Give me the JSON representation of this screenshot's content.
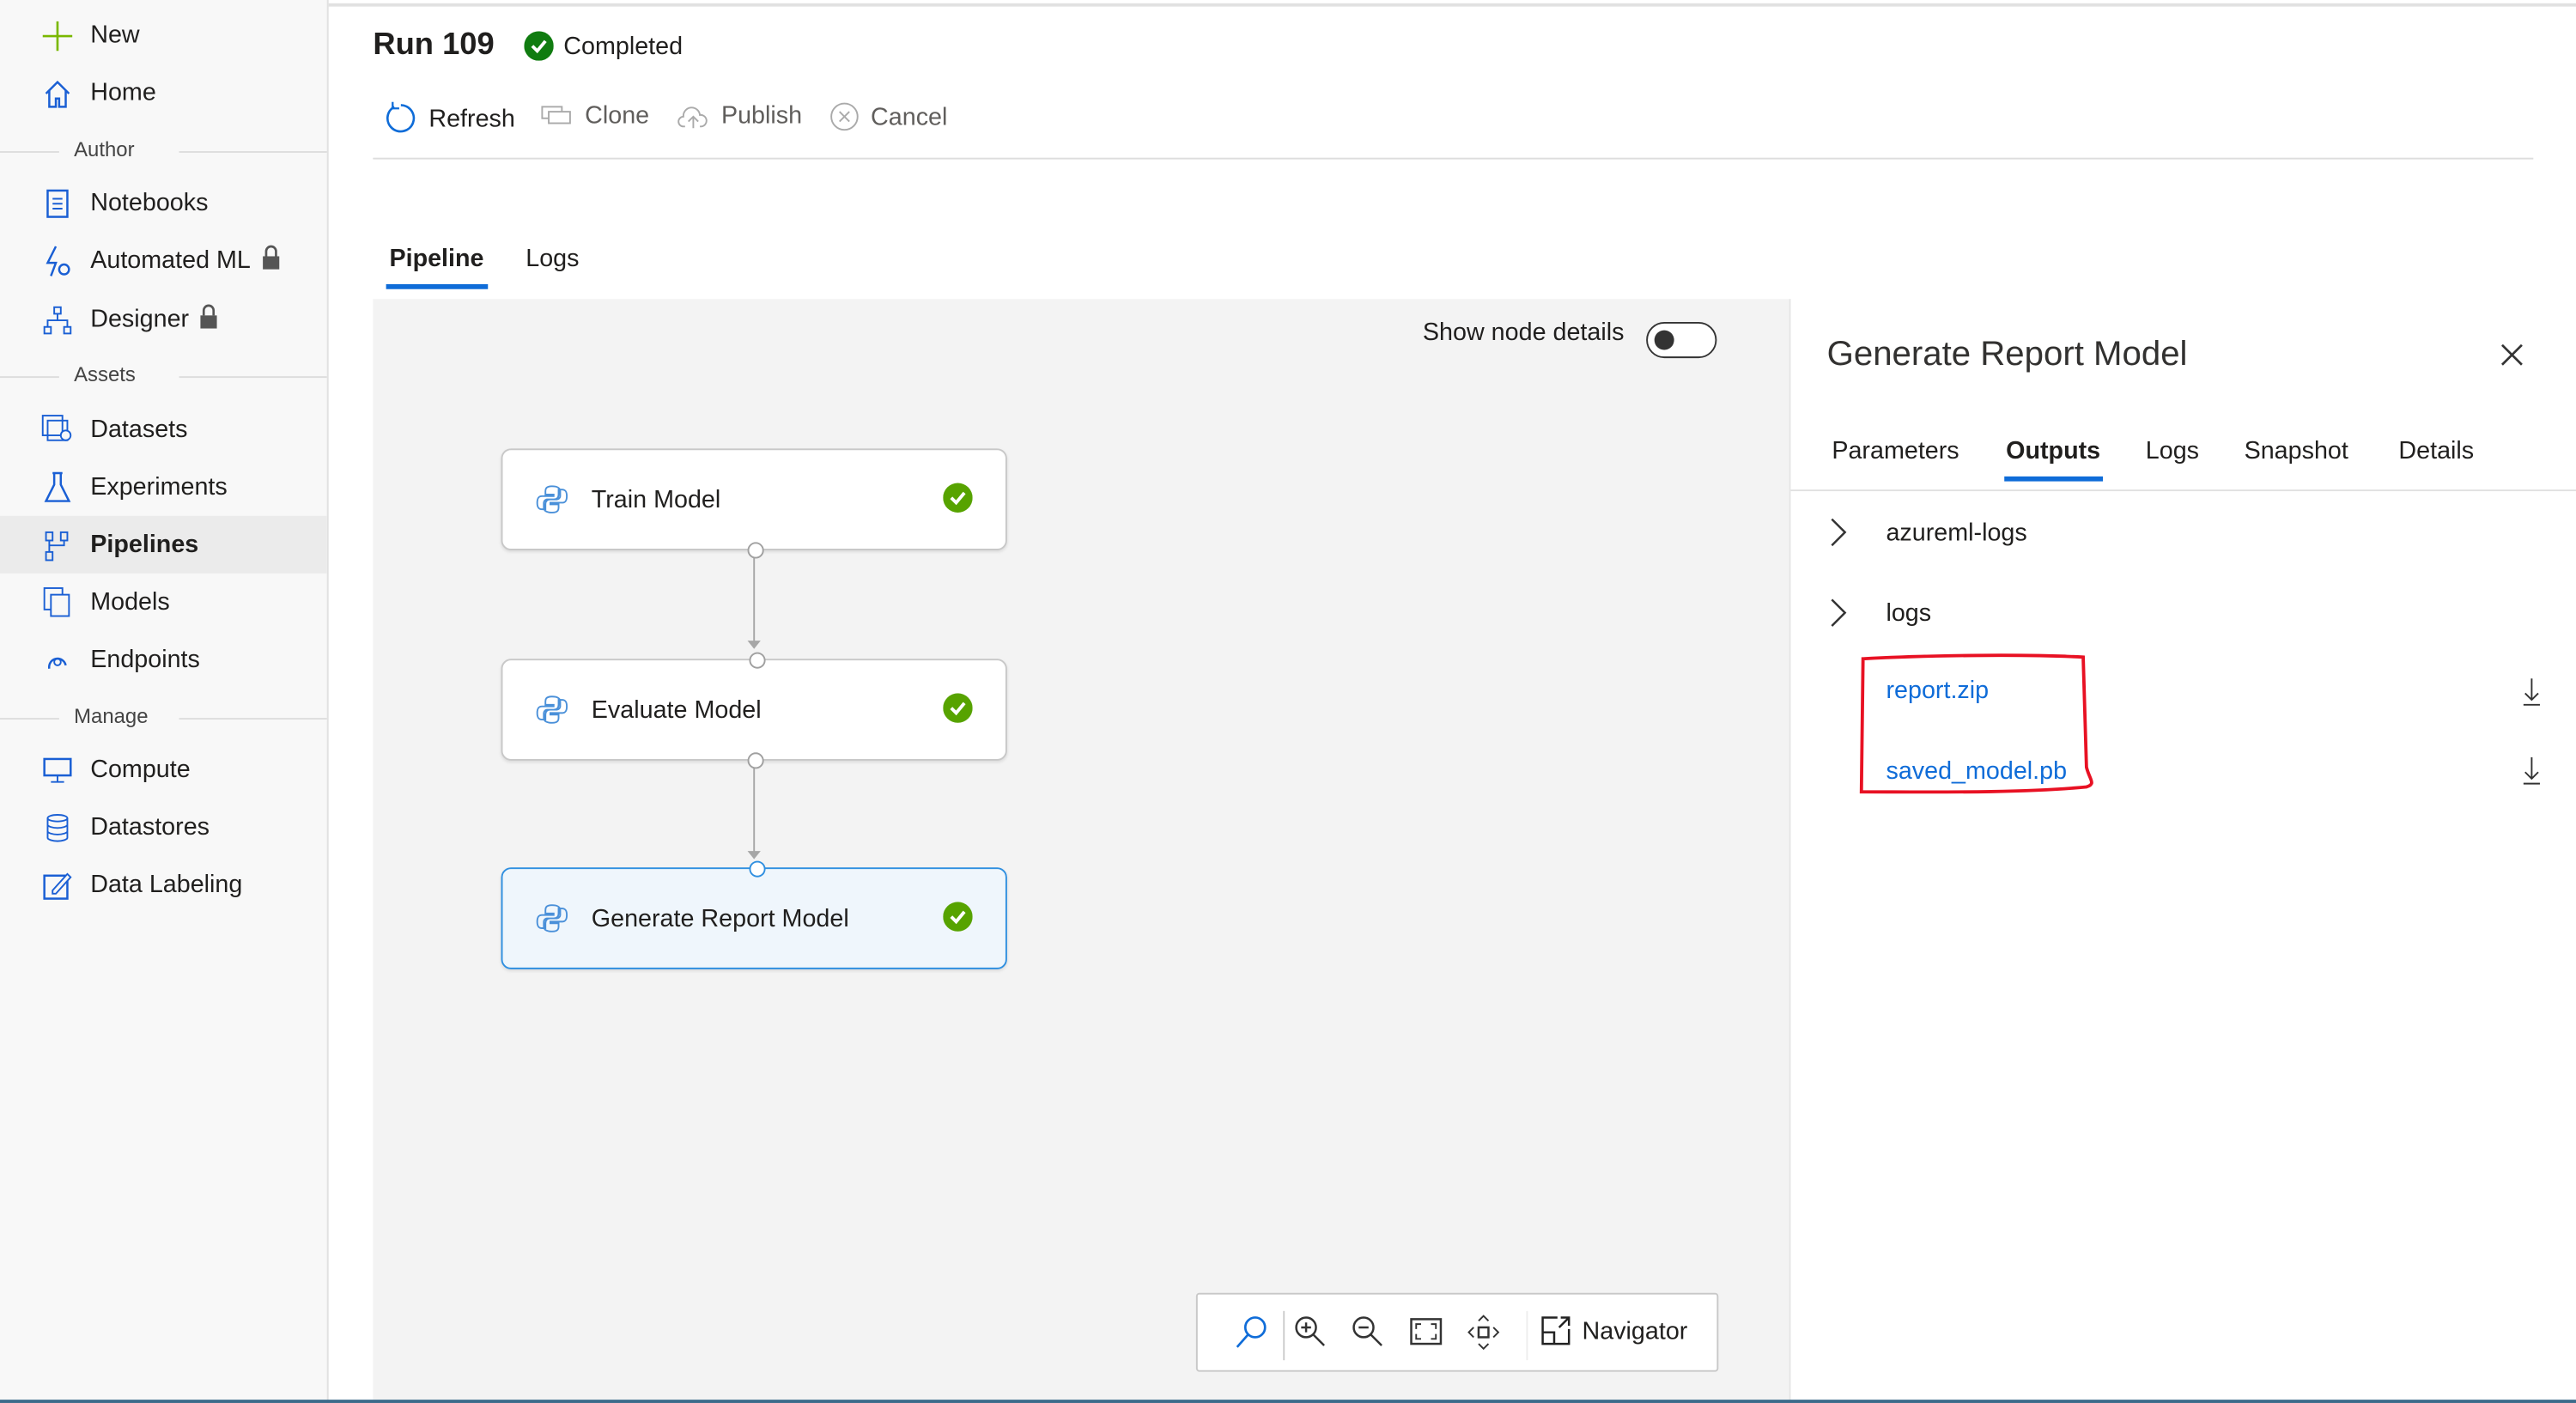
{
  "sidebar": {
    "new_label": "New",
    "home_label": "Home",
    "sections": {
      "author": "Author",
      "assets": "Assets",
      "manage": "Manage"
    },
    "items": [
      {
        "label": "Notebooks",
        "icon": "notebook-icon"
      },
      {
        "label": "Automated ML",
        "icon": "automated-ml-icon",
        "locked": true
      },
      {
        "label": "Designer",
        "icon": "designer-icon",
        "locked": true
      },
      {
        "label": "Datasets",
        "icon": "datasets-icon"
      },
      {
        "label": "Experiments",
        "icon": "flask-icon"
      },
      {
        "label": "Pipelines",
        "icon": "pipeline-icon",
        "selected": true
      },
      {
        "label": "Models",
        "icon": "models-icon"
      },
      {
        "label": "Endpoints",
        "icon": "endpoints-icon"
      },
      {
        "label": "Compute",
        "icon": "compute-icon"
      },
      {
        "label": "Datastores",
        "icon": "datastore-icon"
      },
      {
        "label": "Data Labeling",
        "icon": "data-labeling-icon"
      }
    ]
  },
  "header": {
    "title": "Run 109",
    "status": "Completed",
    "status_color": "#107c10"
  },
  "toolbar": {
    "refresh": "Refresh",
    "clone": "Clone",
    "publish": "Publish",
    "cancel": "Cancel"
  },
  "tabs": [
    {
      "label": "Pipeline",
      "selected": true
    },
    {
      "label": "Logs"
    }
  ],
  "canvas": {
    "show_node_details_label": "Show node details",
    "show_node_details": false,
    "nodes": [
      {
        "label": "Train Model",
        "status": "completed"
      },
      {
        "label": "Evaluate Model",
        "status": "completed"
      },
      {
        "label": "Generate Report Model",
        "status": "completed",
        "selected": true
      }
    ],
    "navigator_label": "Navigator"
  },
  "panel": {
    "title": "Generate Report Model",
    "tabs": [
      {
        "label": "Parameters"
      },
      {
        "label": "Outputs",
        "selected": true
      },
      {
        "label": "Logs"
      },
      {
        "label": "Snapshot"
      },
      {
        "label": "Details"
      }
    ],
    "folders": [
      "azureml-logs",
      "logs"
    ],
    "files": [
      "report.zip",
      "saved_model.pb"
    ]
  },
  "colors": {
    "accent": "#0f6cd8",
    "success": "#57a300",
    "highlight": "#e81123"
  }
}
